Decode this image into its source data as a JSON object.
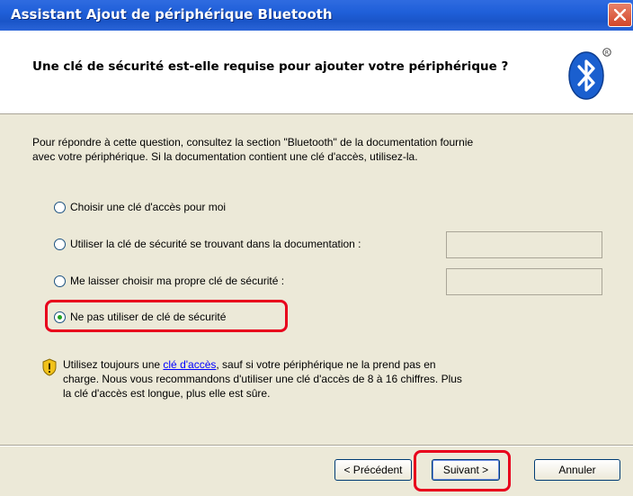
{
  "window": {
    "title": "Assistant Ajout de périphérique Bluetooth",
    "close_icon": "close-icon"
  },
  "header": {
    "heading": "Une clé de sécurité est-elle requise pour ajouter votre périphérique ?",
    "logo_icon": "bluetooth-logo-icon"
  },
  "intro": {
    "line1": "Pour répondre à cette question, consultez la section \"Bluetooth\" de la documentation fournie",
    "line2": "avec votre périphérique. Si la documentation contient une clé d'accès, utilisez-la."
  },
  "options": [
    {
      "label": "Choisir une clé d'accès pour moi",
      "selected": false
    },
    {
      "label": "Utiliser la clé de sécurité se trouvant dans la documentation :",
      "selected": false
    },
    {
      "label": "Me laisser choisir ma propre clé de sécurité :",
      "selected": false
    },
    {
      "label": "Ne pas utiliser de clé de sécurité",
      "selected": true
    }
  ],
  "fields": {
    "documentation_key": "",
    "own_key": ""
  },
  "info": {
    "icon": "shield-warning-icon",
    "before_link": "Utilisez toujours une ",
    "link": "clé d'accès",
    "after_link": ", sauf si votre périphérique ne la prend pas en",
    "line2": "charge. Nous vous recommandons d'utiliser une clé d'accès de 8 à 16 chiffres. Plus",
    "line3": "la clé d'accès est longue, plus elle est sûre."
  },
  "buttons": {
    "back": "< Précédent",
    "next": "Suivant >",
    "cancel": "Annuler"
  },
  "colors": {
    "titlebar": "#1f5fd9",
    "highlight": "#e8001c",
    "bluetooth": "#1a5fcf"
  }
}
